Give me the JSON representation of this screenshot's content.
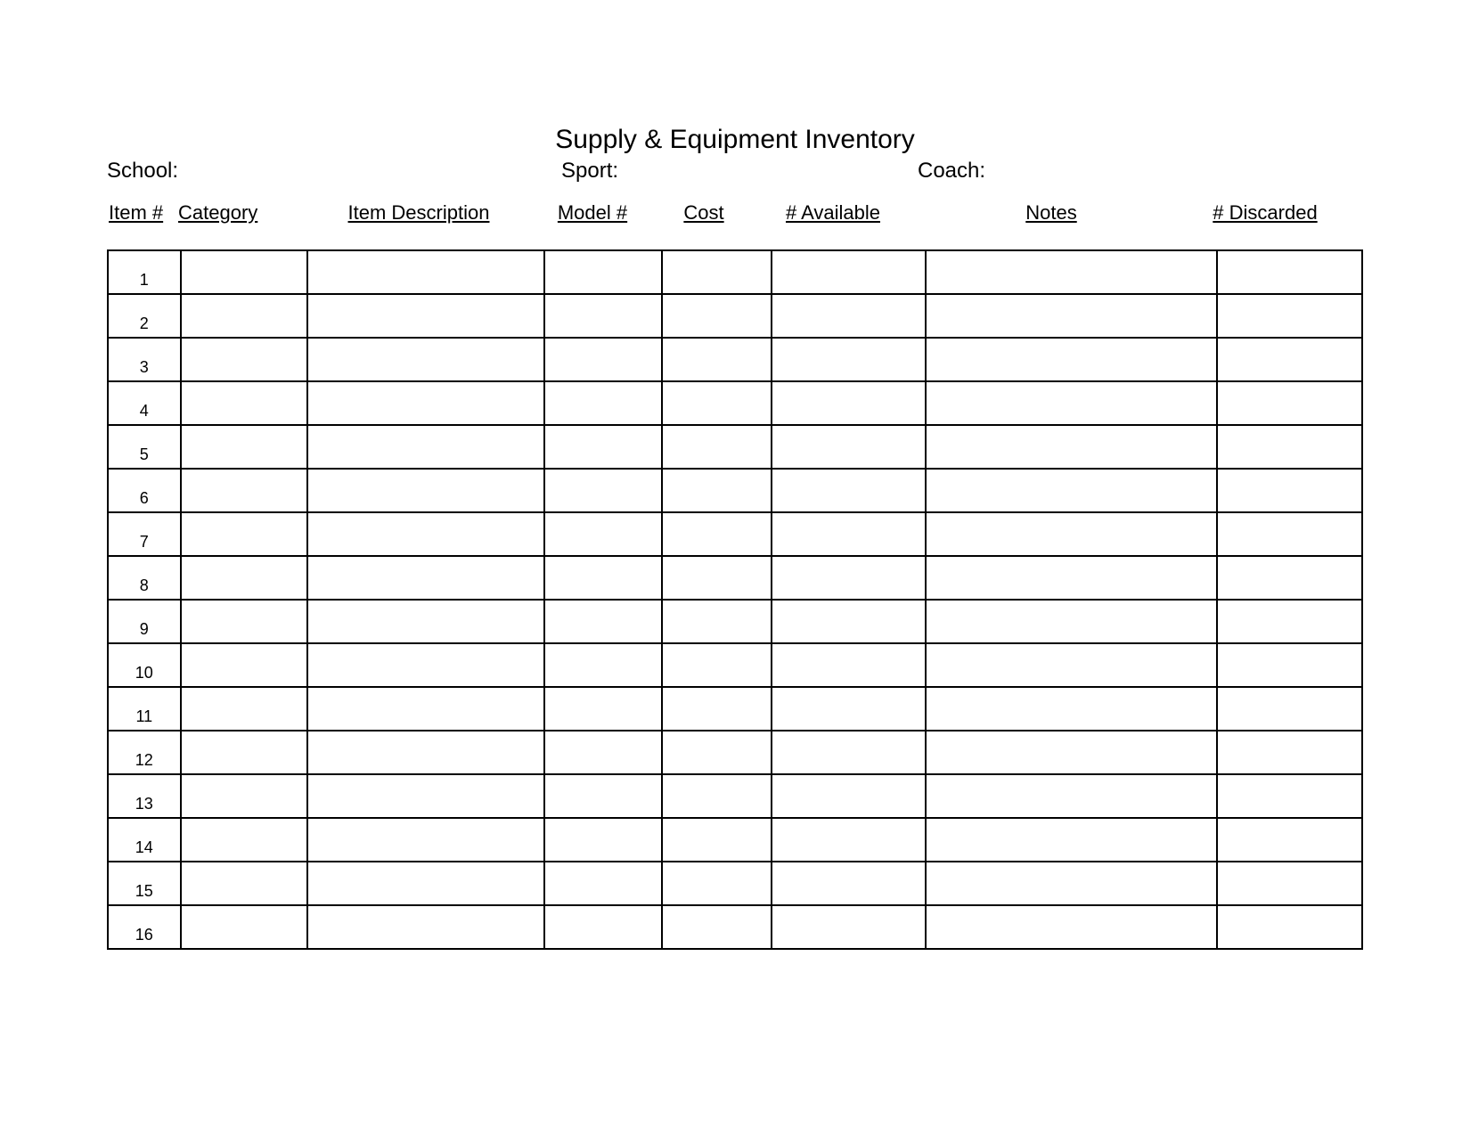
{
  "title": "Supply & Equipment Inventory",
  "meta": {
    "school_label": "School:",
    "sport_label": "Sport:",
    "coach_label": "Coach:"
  },
  "columns": {
    "item": "Item #",
    "category": "Category",
    "description": "Item Description",
    "model": "Model #",
    "cost": "Cost",
    "available": "# Available",
    "notes": "Notes",
    "discarded": "# Discarded"
  },
  "rows": [
    {
      "n": "1",
      "category": "",
      "description": "",
      "model": "",
      "cost": "",
      "available": "",
      "notes": "",
      "discarded": ""
    },
    {
      "n": "2",
      "category": "",
      "description": "",
      "model": "",
      "cost": "",
      "available": "",
      "notes": "",
      "discarded": ""
    },
    {
      "n": "3",
      "category": "",
      "description": "",
      "model": "",
      "cost": "",
      "available": "",
      "notes": "",
      "discarded": ""
    },
    {
      "n": "4",
      "category": "",
      "description": "",
      "model": "",
      "cost": "",
      "available": "",
      "notes": "",
      "discarded": ""
    },
    {
      "n": "5",
      "category": "",
      "description": "",
      "model": "",
      "cost": "",
      "available": "",
      "notes": "",
      "discarded": ""
    },
    {
      "n": "6",
      "category": "",
      "description": "",
      "model": "",
      "cost": "",
      "available": "",
      "notes": "",
      "discarded": ""
    },
    {
      "n": "7",
      "category": "",
      "description": "",
      "model": "",
      "cost": "",
      "available": "",
      "notes": "",
      "discarded": ""
    },
    {
      "n": "8",
      "category": "",
      "description": "",
      "model": "",
      "cost": "",
      "available": "",
      "notes": "",
      "discarded": ""
    },
    {
      "n": "9",
      "category": "",
      "description": "",
      "model": "",
      "cost": "",
      "available": "",
      "notes": "",
      "discarded": ""
    },
    {
      "n": "10",
      "category": "",
      "description": "",
      "model": "",
      "cost": "",
      "available": "",
      "notes": "",
      "discarded": ""
    },
    {
      "n": "11",
      "category": "",
      "description": "",
      "model": "",
      "cost": "",
      "available": "",
      "notes": "",
      "discarded": ""
    },
    {
      "n": "12",
      "category": "",
      "description": "",
      "model": "",
      "cost": "",
      "available": "",
      "notes": "",
      "discarded": ""
    },
    {
      "n": "13",
      "category": "",
      "description": "",
      "model": "",
      "cost": "",
      "available": "",
      "notes": "",
      "discarded": ""
    },
    {
      "n": "14",
      "category": "",
      "description": "",
      "model": "",
      "cost": "",
      "available": "",
      "notes": "",
      "discarded": ""
    },
    {
      "n": "15",
      "category": "",
      "description": "",
      "model": "",
      "cost": "",
      "available": "",
      "notes": "",
      "discarded": ""
    },
    {
      "n": "16",
      "category": "",
      "description": "",
      "model": "",
      "cost": "",
      "available": "",
      "notes": "",
      "discarded": ""
    }
  ]
}
